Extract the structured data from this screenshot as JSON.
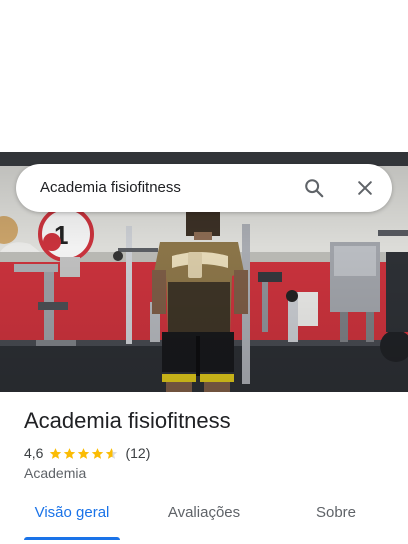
{
  "search": {
    "query": "Academia fisiofitness",
    "search_icon": "search-icon",
    "close_icon": "close-icon"
  },
  "photo": {
    "description_icon": "place-photo"
  },
  "place": {
    "name": "Academia fisiofitness",
    "rating": "4,6",
    "stars": 4.6,
    "review_count": "(12)",
    "category": "Academia"
  },
  "tabs": [
    {
      "label": "Visão geral",
      "active": true
    },
    {
      "label": "Avaliações",
      "active": false
    },
    {
      "label": "Sobre",
      "active": false
    }
  ],
  "colors": {
    "accent": "#1a73e8",
    "star": "#fbbc04",
    "wall_red": "#c8323c"
  }
}
